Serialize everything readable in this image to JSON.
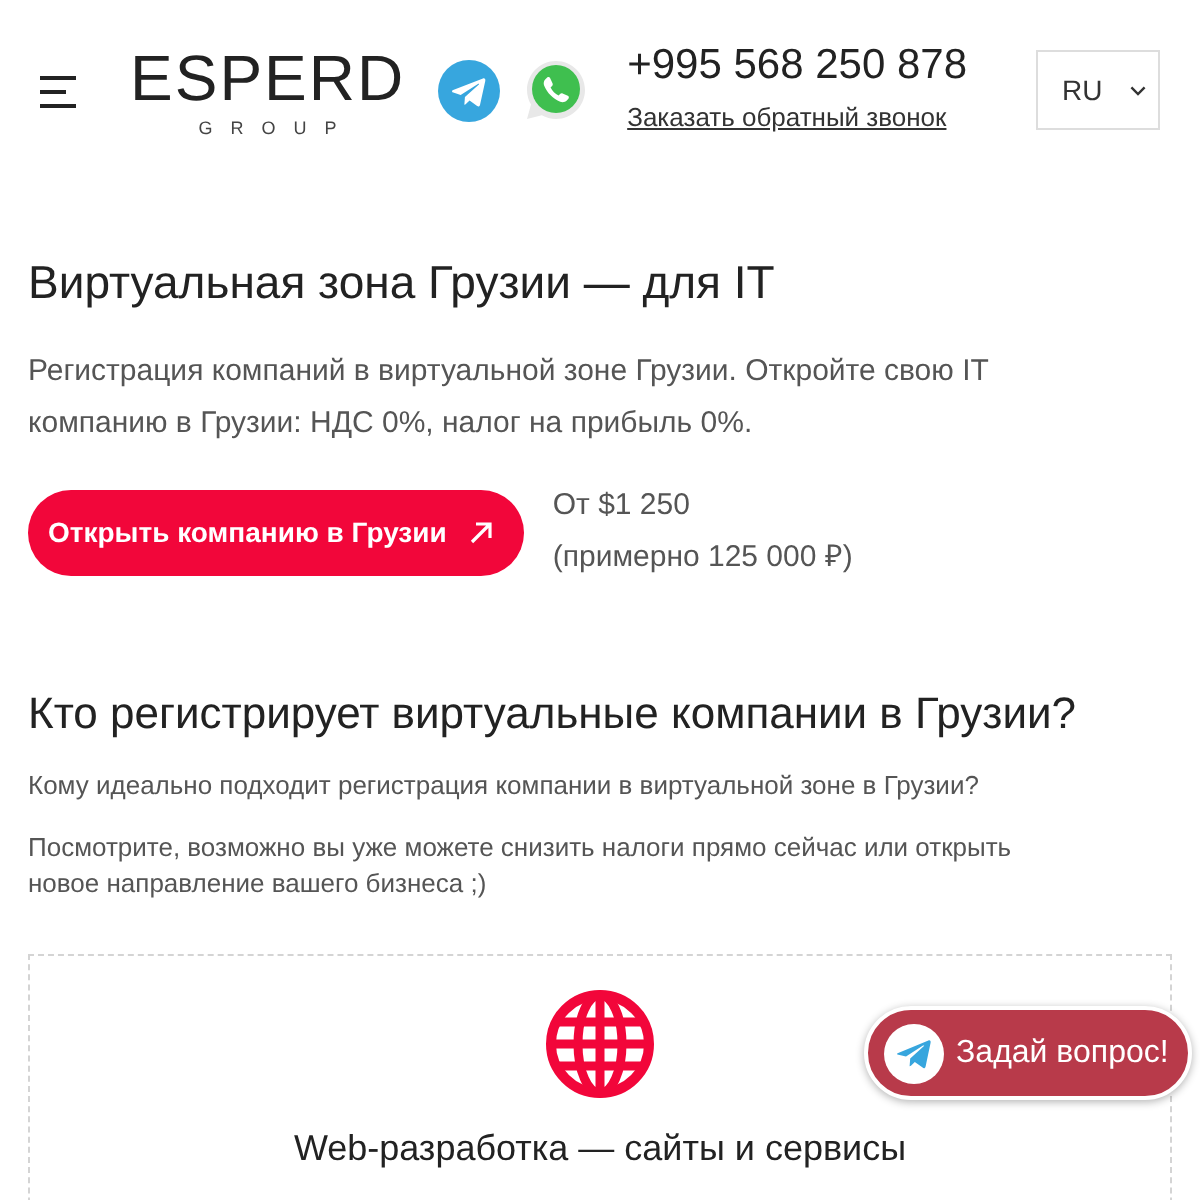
{
  "header": {
    "logo": {
      "name": "ESPERD",
      "subtitle": "GROUP"
    },
    "phone": "+995 568 250 878",
    "callback_link": "Заказать обратный звонок",
    "language_select": {
      "value": "RU"
    }
  },
  "hero": {
    "title": "Виртуальная зона Грузии — для IT",
    "description": "Регистрация компаний в виртуальной зоне Грузии. Откройте свою IT компанию в Грузии: НДС 0%, налог на прибыль 0%.",
    "cta_button": "Открыть компанию в Грузии",
    "price": "От $1 250",
    "price_note": "(примерно 125 000 ₽)"
  },
  "audience": {
    "title": "Кто регистрирует виртуальные компании в Грузии?",
    "intro": "Кому идеально подходит регистрация компании в виртуальной зоне в Грузии?",
    "note": "Посмотрите, возможно вы уже можете снизить налоги прямо сейчас или открыть новое направление вашего бизнеса ;)"
  },
  "services": [
    {
      "title": "Web-разработка — сайты и сервисы"
    }
  ],
  "chat_button": {
    "label": "Задай вопрос!"
  }
}
